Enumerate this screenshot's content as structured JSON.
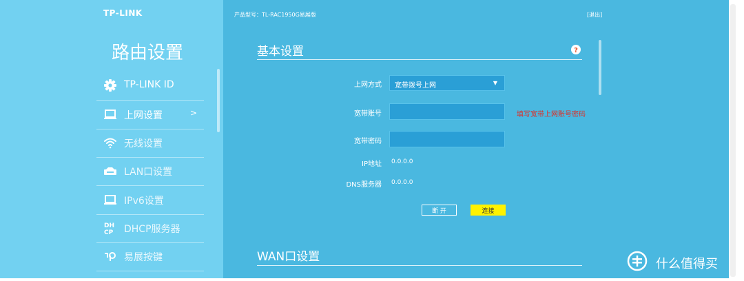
{
  "brand": "TP-LINK",
  "header": {
    "product": "产品型号：TL-RAC1950G易展版",
    "logout": "[退出]"
  },
  "sidebar": {
    "title": "路由设置",
    "items": [
      {
        "label": "TP-LINK ID",
        "icon": "gear-icon"
      },
      {
        "label": "上网设置",
        "icon": "monitor-icon",
        "active": true,
        "arrow": ">"
      },
      {
        "label": "无线设置",
        "icon": "wifi-icon"
      },
      {
        "label": "LAN口设置",
        "icon": "lan-icon"
      },
      {
        "label": "IPv6设置",
        "icon": "monitor-icon"
      },
      {
        "label": "DHCP服务器",
        "icon": "dhcp-icon"
      },
      {
        "label": "易展按键",
        "icon": "easymesh-icon"
      }
    ]
  },
  "basic": {
    "title": "基本设置",
    "help_icon": "help-icon",
    "fields": {
      "mode_label": "上网方式",
      "mode_value": "宽带拨号上网",
      "account_label": "宽带账号",
      "account_value": "",
      "password_label": "宽带密码",
      "password_value": "",
      "ip_label": "IP地址",
      "ip_value": "0.0.0.0",
      "dns_label": "DNS服务器",
      "dns_value": "0.0.0.0"
    },
    "hint": "填写宽带上网账号密码",
    "buttons": {
      "disconnect": "断 开",
      "connect": "连接"
    }
  },
  "wan": {
    "title": "WAN口设置"
  },
  "watermark": {
    "text": "什么值得买",
    "icon": "smzdm-logo-icon"
  },
  "colors": {
    "main_bg": "#4ab8e0",
    "sidebar_bg": "#72d1f1",
    "input_bg": "#2a9fd6",
    "hint": "#d9322b",
    "connect_button": "#fff200"
  }
}
